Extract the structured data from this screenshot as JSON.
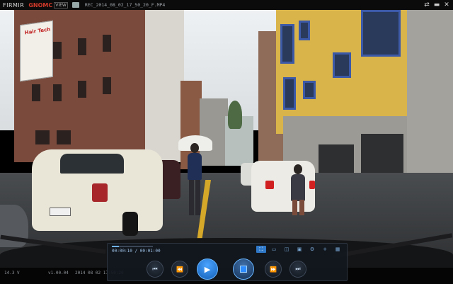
{
  "titlebar": {
    "brand_left": "FIRMIR",
    "brand_right": "GNOMC",
    "brand_badge": "VIEW",
    "filename": "REC_2014_08_02_17_50_20_F.MP4",
    "buttons": [
      "⇄",
      "▬",
      "✕"
    ]
  },
  "scene": {
    "sign_text": "Hair Tech"
  },
  "player": {
    "time": "00:00:10 / 00:01:00",
    "progress": 0.17,
    "tools": [
      "⛶",
      "▭",
      "◫",
      "▣",
      "⚙",
      "+",
      "▦"
    ],
    "active_tool_index": 0,
    "controls": {
      "prev": "⏮",
      "rewind": "⏪",
      "play": "▶",
      "stop": "■",
      "forward": "⏩",
      "next": "⏭"
    }
  },
  "statusbar": {
    "speed": "14.3 V",
    "version": "v1.00.04",
    "timestamp": "2014 08 02 17:50:20"
  },
  "colors": {
    "accent": "#2f79c8",
    "lane": "#d6a82a"
  }
}
